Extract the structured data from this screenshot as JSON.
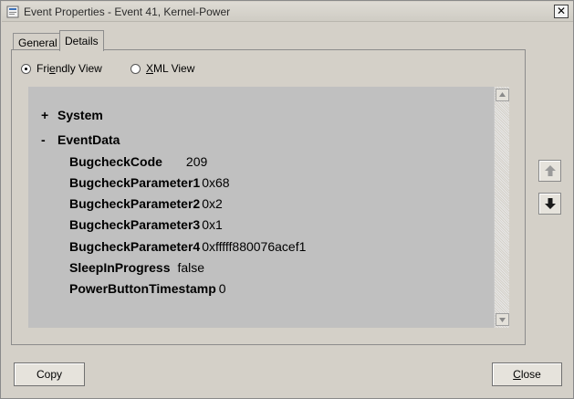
{
  "window": {
    "title": "Event Properties - Event 41, Kernel-Power"
  },
  "tabs": [
    {
      "label": "General"
    },
    {
      "label": "Details"
    }
  ],
  "view_options": {
    "friendly_pre": "Fri",
    "friendly_u": "e",
    "friendly_post": "ndly View",
    "xml_u": "X",
    "xml_post": "ML View",
    "selected": "Friendly View"
  },
  "tree": {
    "system": {
      "toggle": "+",
      "label": "System"
    },
    "eventdata": {
      "toggle": "-",
      "label": "EventData"
    }
  },
  "properties": [
    {
      "name": "BugcheckCode",
      "value": "209"
    },
    {
      "name": "BugcheckParameter1",
      "value": "0x68"
    },
    {
      "name": "BugcheckParameter2",
      "value": "0x2"
    },
    {
      "name": "BugcheckParameter3",
      "value": "0x1"
    },
    {
      "name": "BugcheckParameter4",
      "value": "0xfffff880076acef1"
    },
    {
      "name": "SleepInProgress",
      "value": "false"
    },
    {
      "name": "PowerButtonTimestamp",
      "value": "0"
    }
  ],
  "buttons": {
    "copy": "Copy",
    "close_u": "C",
    "close_post": "lose"
  },
  "close_glyph": "✕"
}
